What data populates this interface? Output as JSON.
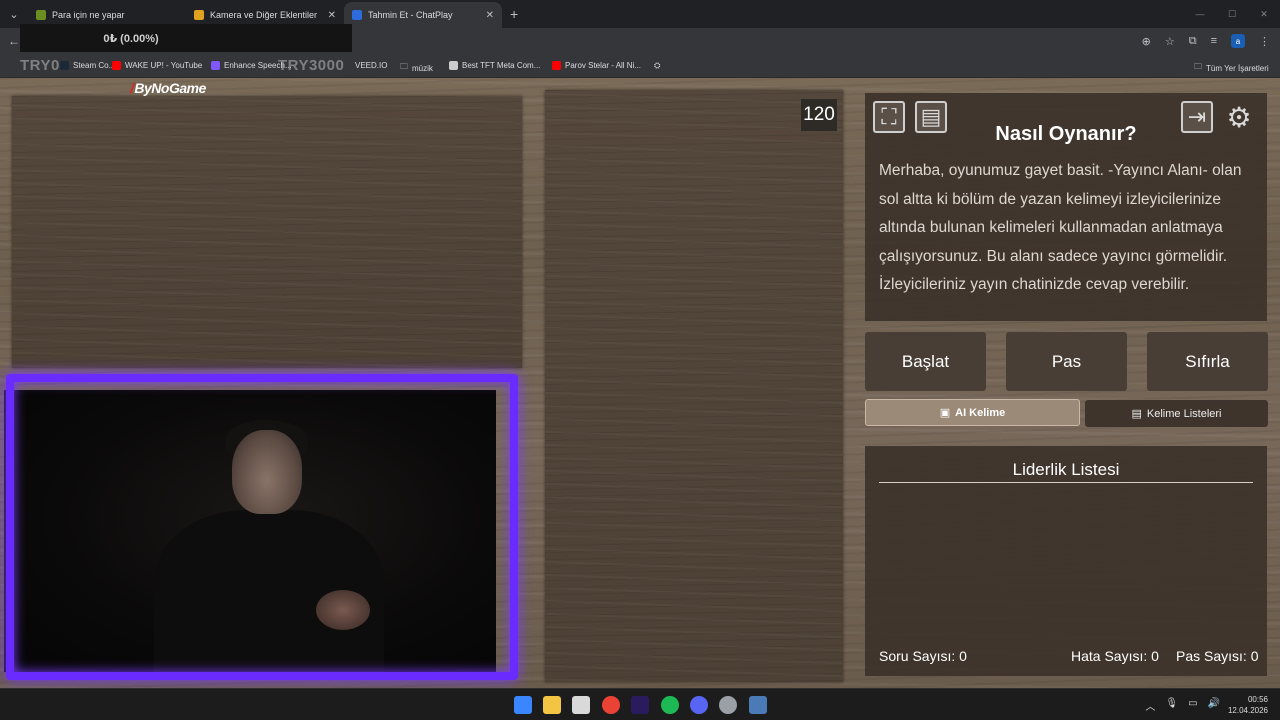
{
  "browser": {
    "tabs": [
      {
        "title": "Para için ne yapar",
        "favicon_color": "#6b8e23",
        "active": false
      },
      {
        "title": "Kamera ve Diğer Eklentiler",
        "favicon_color": "#e0a020",
        "active": false
      },
      {
        "title": "Tahmin Et - ChatPlay",
        "favicon_color": "#2d6cdf",
        "active": true
      }
    ],
    "tab_close": "✕",
    "new_tab": "+",
    "overlay_price": "0₺ (0.00%)",
    "try_left": "TRY0",
    "try_mid": "TRY3000",
    "bookmarks": [
      {
        "label": "Steam Co...",
        "color": "#1b2838"
      },
      {
        "label": "WAKE UP! - YouTube",
        "color": "#ff0000"
      },
      {
        "label": "Enhance Speech...",
        "color": "#7e57ff"
      },
      {
        "label": "VEED.IO",
        "color": "#bbbbbb"
      },
      {
        "label": "müzik",
        "color": "#9aa0a6"
      },
      {
        "label": "Best TFT Meta Com...",
        "color": "#cccccc"
      },
      {
        "label": "Parov Stelar - All Ni...",
        "color": "#ff0000"
      }
    ],
    "all_bookmarks": "Tüm Yer İşaretleri",
    "profile_initial": "a"
  },
  "app": {
    "logo": "ByNoGame",
    "timer": "120",
    "how_title": "Nasıl Oynanır?",
    "how_text": "Merhaba, oyunumuz gayet basit. -Yayıncı Alanı- olan sol altta ki bölüm de yazan kelimeyi izleyicilerinize altında bulunan kelimeleri kullanmadan anlatmaya çalışıyorsunuz. Bu alanı sadece yayıncı görmelidir. İzleyicileriniz yayın chatinizde cevap verebilir.",
    "buttons": {
      "start": "Başlat",
      "pass": "Pas",
      "reset": "Sıfırla",
      "ai_word": "AI Kelime",
      "word_lists": "Kelime Listeleri"
    },
    "leaderboard_title": "Liderlik Listesi",
    "stats": {
      "questions": "Soru Sayısı: 0",
      "errors": "Hata Sayısı: 0",
      "passes": "Pas Sayısı: 0"
    }
  },
  "taskbar": {
    "time": "00:56",
    "date": "12.04.2026"
  }
}
